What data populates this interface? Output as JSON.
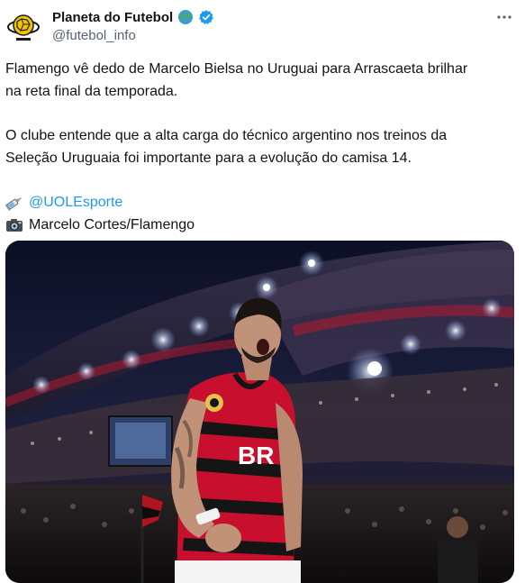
{
  "author": {
    "display_name": "Planeta do Futebol",
    "handle": "@futebol_info",
    "verified": true,
    "icons": [
      "globe-icon",
      "verified-badge-icon"
    ]
  },
  "tweet": {
    "line1": "Flamengo vê dedo de Marcelo Bielsa no Uruguai para Arrascaeta brilhar",
    "line2": "na reta final da temporada.",
    "line3": "O clube entende que a alta carga do técnico argentino nos treinos da",
    "line4": "Seleção Uruguaia foi importante para a evolução do camisa 14.",
    "source_mention": "@UOLEsporte",
    "photo_credit": "Marcelo Cortes/Flamengo"
  },
  "media": {
    "description_icons": [
      "syringe-icon",
      "camera-icon"
    ],
    "jersey_text": "BR"
  },
  "colors": {
    "accent": "#1d9bf0",
    "text": "#0f1419",
    "secondary": "#536471",
    "jersey_red": "#c8102e",
    "jersey_black": "#151515"
  }
}
